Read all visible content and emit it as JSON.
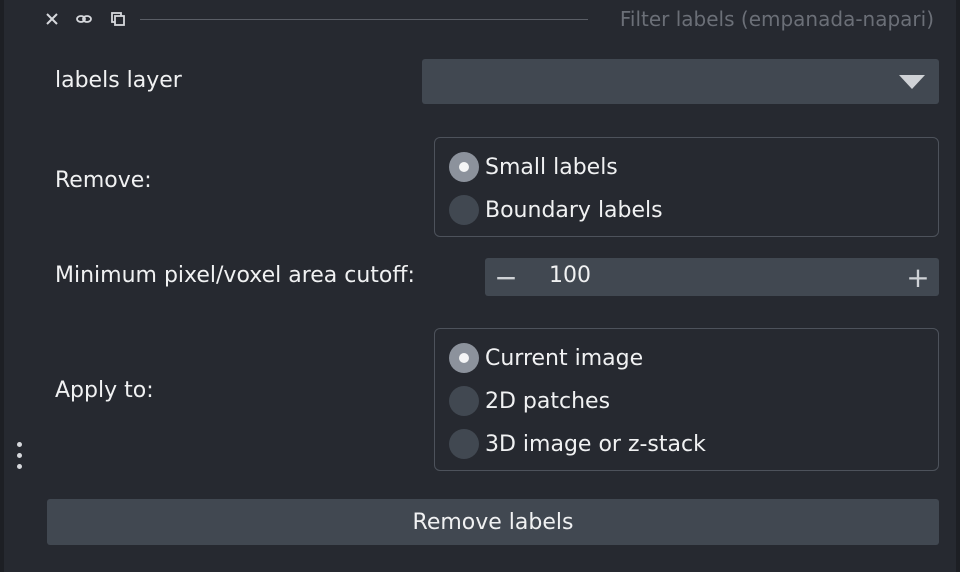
{
  "titlebar": {
    "title": "Filter labels (empanada-napari)",
    "icons": [
      "close-icon",
      "float-icon",
      "minimize-icon"
    ]
  },
  "form": {
    "labels_layer": {
      "label": "labels layer",
      "value": ""
    },
    "remove": {
      "label": "Remove:",
      "options": [
        "Small labels",
        "Boundary labels"
      ],
      "selected": "Small labels"
    },
    "cutoff": {
      "label": "Minimum pixel/voxel area cutoff:",
      "value": "100",
      "minus": "−",
      "plus": "+"
    },
    "apply_to": {
      "label": "Apply to:",
      "options": [
        "Current image",
        "2D patches",
        "3D image or z-stack"
      ],
      "selected": "Current image"
    },
    "submit_label": "Remove labels"
  },
  "colors": {
    "background": "#262930",
    "widget": "#414851",
    "text": "#f0f1f2",
    "title_text": "#6b6f77"
  }
}
